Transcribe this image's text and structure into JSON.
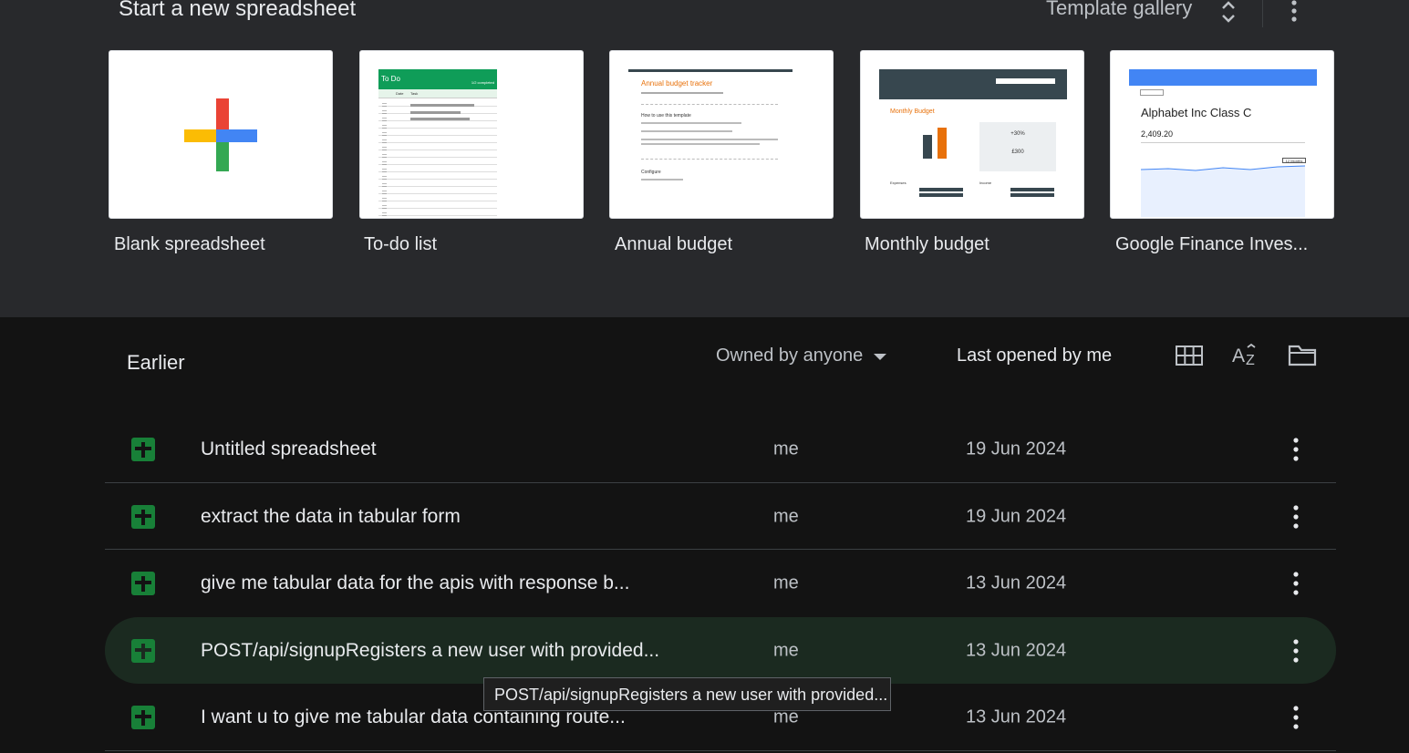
{
  "top": {
    "title": "Start a new spreadsheet",
    "gallery_label": "Template gallery"
  },
  "templates": [
    {
      "label": "Blank spreadsheet"
    },
    {
      "label": "To-do list"
    },
    {
      "label": "Annual budget"
    },
    {
      "label": "Monthly budget"
    },
    {
      "label": "Google Finance Inves..."
    }
  ],
  "previews": {
    "todo": {
      "header": "To Do",
      "sub": "1/2 completed",
      "col_date": "Date",
      "col_task": "Task"
    },
    "annual": {
      "title": "Annual budget tracker",
      "section1": "How to use this template",
      "section2": "Configure"
    },
    "monthly": {
      "title": "Monthly Budget",
      "stat1": "+30%",
      "stat2": "£300",
      "expenses": "Expenses",
      "income": "Income"
    },
    "finance": {
      "title": "Alphabet Inc Class C",
      "price": "2,409.20",
      "range": "12 Months"
    }
  },
  "list": {
    "section": "Earlier",
    "filter_owner": "Owned by anyone",
    "sort_label": "Last opened by me",
    "rows": [
      {
        "name": "Untitled spreadsheet",
        "owner": "me",
        "date": "19 Jun 2024"
      },
      {
        "name": "extract the data in tabular form",
        "owner": "me",
        "date": "19 Jun 2024"
      },
      {
        "name": "give me tabular data for the apis with response b...",
        "owner": "me",
        "date": "13 Jun 2024"
      },
      {
        "name": "POST/api/signupRegisters a new user with provided...",
        "owner": "me",
        "date": "13 Jun 2024"
      },
      {
        "name": "I want u to give me tabular data containing route...",
        "owner": "me",
        "date": "13 Jun 2024"
      }
    ]
  },
  "tooltip": {
    "text": "POST/api/signupRegisters a new user with provided..."
  },
  "colors": {
    "sheets_green": "#188038",
    "hover_row": "#1b2a20",
    "accent_orange": "#e8710a"
  }
}
